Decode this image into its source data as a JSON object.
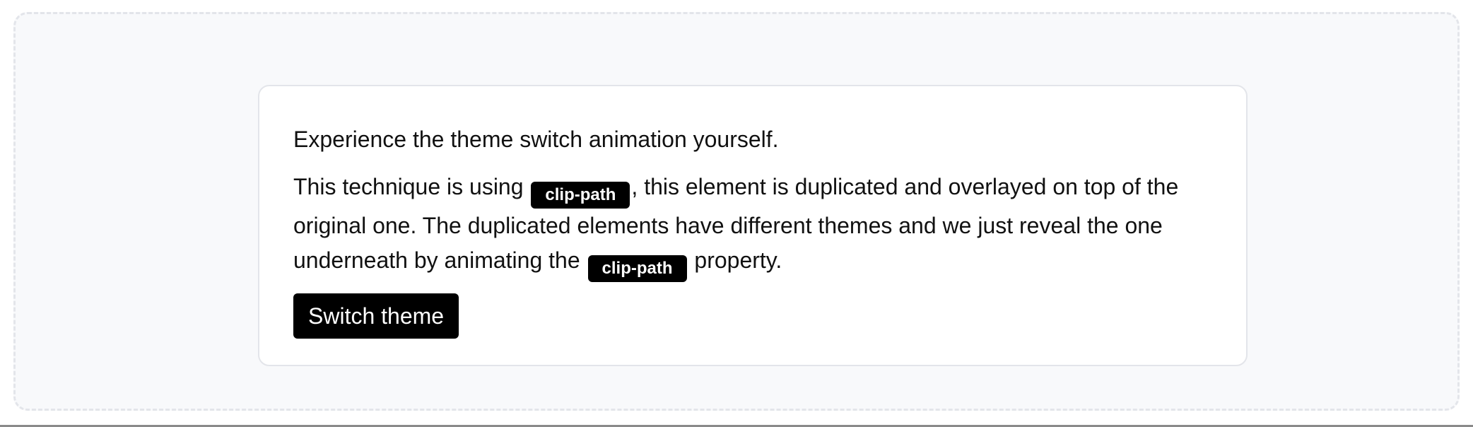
{
  "card": {
    "intro": "Experience the theme switch animation yourself.",
    "desc_part1": "This technique is using",
    "code1": "clip-path",
    "desc_part2": ", this element is duplicated and overlayed on top of the original one. The duplicated elements have different themes and we just reveal the one underneath by animating the",
    "code2": "clip-path",
    "desc_part3": "property.",
    "button_label": "Switch theme"
  },
  "colors": {
    "frame_bg": "#f8f9fb",
    "frame_border": "#e3e5ea",
    "card_bg": "#ffffff",
    "accent": "#000000",
    "text": "#111111"
  }
}
